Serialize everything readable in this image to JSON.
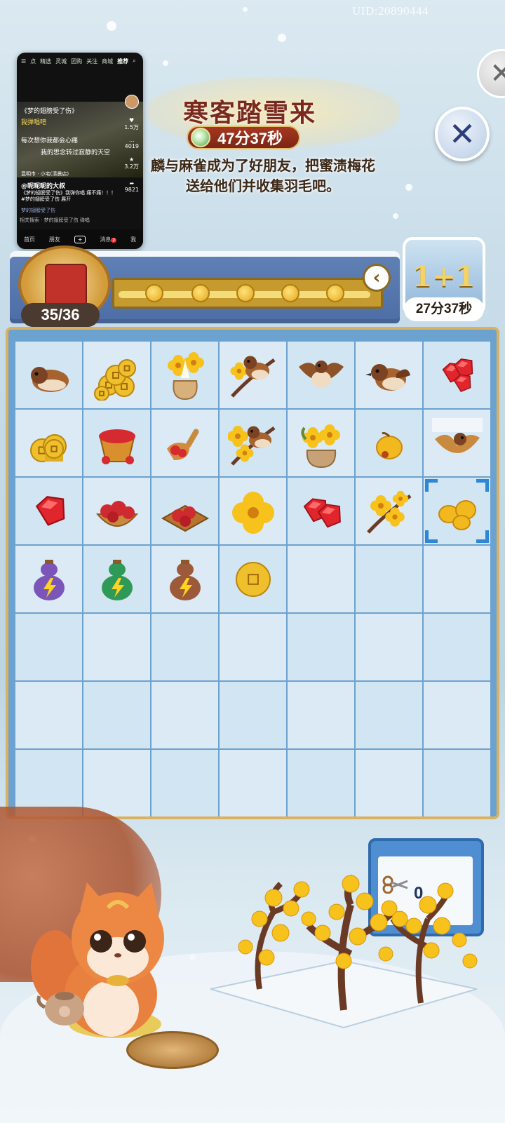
{
  "uid": "UID:20890444",
  "event": {
    "title": "寒客踏雪来",
    "timer": "47分37秒",
    "description_line1": "麟与麻雀成为了好朋友，把蜜渍梅花",
    "description_line2": "送给他们并收集羽毛吧。"
  },
  "progress": {
    "counter": "35/36",
    "fraction": 0.97
  },
  "bonus": {
    "label": "1+1",
    "timer": "27分37秒"
  },
  "shears_count": "0",
  "pip": {
    "tabs": [
      "点",
      "精选",
      "灵城",
      "团购",
      "关注",
      "商城",
      "推荐"
    ],
    "active_tab": "推荐",
    "caption_top": "《梦的翅膀受了伤》",
    "lyric1": "我弹唱吧",
    "lyric2": "每次想你我都会心痛",
    "lyric3": "我的思念转过寂静的天空",
    "location": "昆明市 · 小宅(清晨店)",
    "author": "@昵昵昵的大叔",
    "text1": "《梦的翅膀受了伤》我弹你唱 痛不痛！！！#梦的翅膀受了伤 展开",
    "text2": "梦的翅膀受了伤",
    "likes": "1.5万",
    "comments": "4019",
    "favorites": "3.2万",
    "shares": "9821",
    "search": "相关搜索 · 梦的翅膀受了伤 弹唱",
    "nav": [
      "首页",
      "朋友",
      "+",
      "消息",
      "我"
    ],
    "badge": "2"
  },
  "grid": {
    "rows": 7,
    "cols": 7,
    "items": [
      [
        "sparrow-resting",
        "coin-pile-large",
        "flower-vase-lily",
        "sparrow-on-plum-branch",
        "sparrow-flying",
        "sparrow-standing",
        "ruby-gems-cluster"
      ],
      [
        "coin-stack",
        "rose-petal-bucket",
        "petal-scoop",
        "sparrow-on-blossom-branch",
        "plum-flower-pot",
        "bud",
        "sparrow-flying-snow"
      ],
      [
        "ruby-gem",
        "rose-bowl",
        "rose-tray",
        "plum-blossom",
        "ruby-gems-pair",
        "plum-branch",
        "plum-buds"
      ],
      [
        "energy-gourd-purple",
        "energy-gourd-green",
        "energy-gourd-brown",
        "copper-coin",
        "",
        "",
        ""
      ],
      [
        "",
        "",
        "",
        "",
        "",
        "",
        ""
      ],
      [
        "",
        "",
        "",
        "",
        "",
        "",
        ""
      ],
      [
        "",
        "",
        "",
        "",
        "",
        "",
        ""
      ]
    ],
    "selected": [
      2,
      6
    ]
  }
}
